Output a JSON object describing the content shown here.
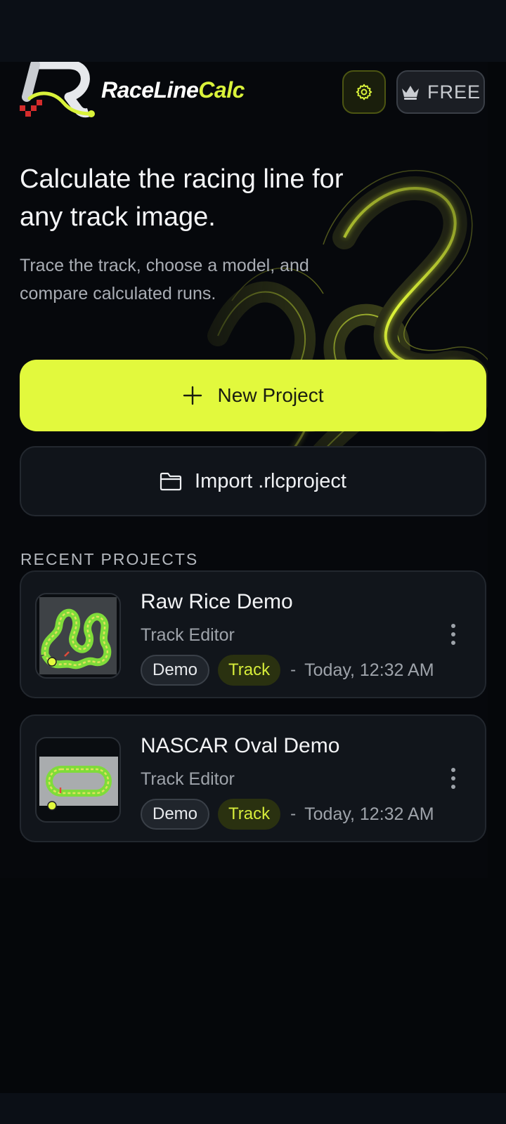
{
  "brand": {
    "name_part1": "RaceLine",
    "name_part2": "Calc",
    "accent": "#e2f93d",
    "background": "#06080c"
  },
  "header": {
    "settings_icon": "gear-icon",
    "plan_icon": "crown-icon",
    "plan_label": "FREE"
  },
  "hero": {
    "headline": "Calculate the racing line for any track image.",
    "subtext": "Trace the track, choose a model, and compare calculated runs."
  },
  "actions": {
    "new_project_icon": "plus-icon",
    "new_project_label": "New Project",
    "import_icon": "folder-icon",
    "import_label": "Import .rlcproject"
  },
  "recent": {
    "title": "RECENT PROJECTS",
    "projects": [
      {
        "name": "Raw Rice Demo",
        "subtitle": "Track Editor",
        "tags": [
          "Demo",
          "Track"
        ],
        "separator": "-",
        "date": "Today, 12:32 AM",
        "thumbnail": "twisty-track-thumbnail",
        "menu_icon": "more-vertical-icon"
      },
      {
        "name": "NASCAR Oval Demo",
        "subtitle": "Track Editor",
        "tags": [
          "Demo",
          "Track"
        ],
        "separator": "-",
        "date": "Today, 12:32 AM",
        "thumbnail": "oval-track-thumbnail",
        "menu_icon": "more-vertical-icon"
      }
    ]
  }
}
